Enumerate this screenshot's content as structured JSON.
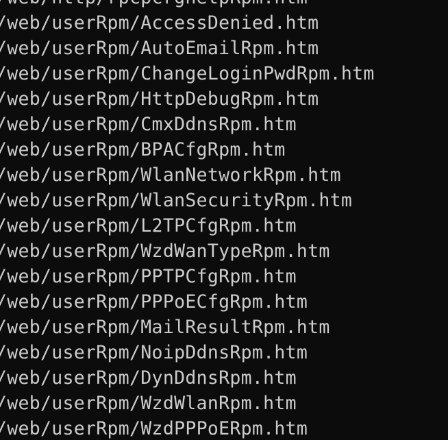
{
  "terminal": {
    "lines": [
      "/web/http/rpcpcrgnetpRpm.htm",
      "/web/userRpm/AccessDenied.htm",
      "/web/userRpm/AutoEmailRpm.htm",
      "/web/userRpm/ChangeLoginPwdRpm.htm",
      "/web/userRpm/HttpDebugRpm.htm",
      "/web/userRpm/CmxDdnsRpm.htm",
      "/web/userRpm/BPACfgRpm.htm",
      "/web/userRpm/WlanNetworkRpm.htm",
      "/web/userRpm/WlanSecurityRpm.htm",
      "/web/userRpm/L2TPCfgRpm.htm",
      "/web/userRpm/WzdWanTypeRpm.htm",
      "/web/userRpm/PPTPCfgRpm.htm",
      "/web/userRpm/PPPoECfgRpm.htm",
      "/web/userRpm/MailResultRpm.htm",
      "/web/userRpm/NoipDdnsRpm.htm",
      "/web/userRpm/DynDdnsRpm.htm",
      "/web/userRpm/WzdWlanRpm.htm",
      "/web/userRpm/WzdPPPoERpm.htm"
    ]
  },
  "colors": {
    "background": "#0c0c0c",
    "text": "#cccccc"
  }
}
